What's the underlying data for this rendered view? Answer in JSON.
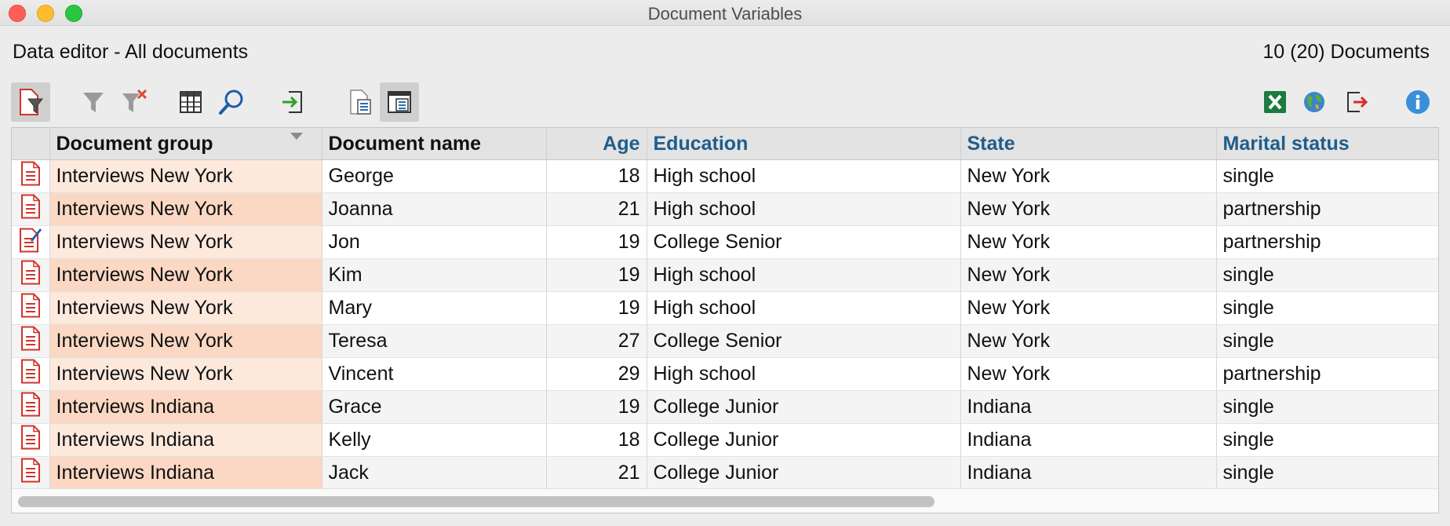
{
  "window": {
    "title": "Document Variables"
  },
  "header": {
    "title": "Data editor - All documents",
    "count": "10 (20) Documents"
  },
  "toolbar": {
    "icons": [
      "filter-active-icon",
      "filter-icon",
      "clear-filter-icon",
      "table-columns-icon",
      "search-icon",
      "import-icon",
      "document-list-icon",
      "document-view-icon",
      "excel-export-icon",
      "globe-icon",
      "exit-icon",
      "info-icon"
    ]
  },
  "table": {
    "columns": [
      "Document group",
      "Document name",
      "Age",
      "Education",
      "State",
      "Marital status"
    ],
    "rows": [
      {
        "icon": "document-icon",
        "group": "Interviews New York",
        "name": "George",
        "age": "18",
        "education": "High school",
        "state": "New York",
        "marital": "single"
      },
      {
        "icon": "document-icon",
        "group": "Interviews New York",
        "name": "Joanna",
        "age": "21",
        "education": "High school",
        "state": "New York",
        "marital": "partnership"
      },
      {
        "icon": "document-edit-icon",
        "group": "Interviews New York",
        "name": "Jon",
        "age": "19",
        "education": "College Senior",
        "state": "New York",
        "marital": "partnership"
      },
      {
        "icon": "document-icon",
        "group": "Interviews New York",
        "name": "Kim",
        "age": "19",
        "education": "High school",
        "state": "New York",
        "marital": "single"
      },
      {
        "icon": "document-icon",
        "group": "Interviews New York",
        "name": "Mary",
        "age": "19",
        "education": "High school",
        "state": "New York",
        "marital": "single"
      },
      {
        "icon": "document-icon",
        "group": "Interviews New York",
        "name": "Teresa",
        "age": "27",
        "education": "College Senior",
        "state": "New York",
        "marital": "single"
      },
      {
        "icon": "document-icon",
        "group": "Interviews New York",
        "name": "Vincent",
        "age": "29",
        "education": "High school",
        "state": "New York",
        "marital": "partnership"
      },
      {
        "icon": "document-icon",
        "group": "Interviews Indiana",
        "name": "Grace",
        "age": "19",
        "education": "College Junior",
        "state": "Indiana",
        "marital": "single"
      },
      {
        "icon": "document-icon",
        "group": "Interviews Indiana",
        "name": "Kelly",
        "age": "18",
        "education": "College Junior",
        "state": "Indiana",
        "marital": "single"
      },
      {
        "icon": "document-icon",
        "group": "Interviews Indiana",
        "name": "Jack",
        "age": "21",
        "education": "College Junior",
        "state": "Indiana",
        "marital": "single"
      }
    ]
  }
}
